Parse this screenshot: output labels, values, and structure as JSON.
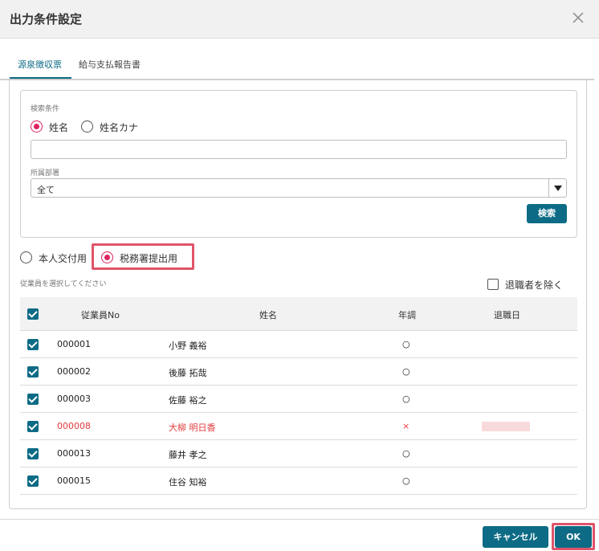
{
  "dialog": {
    "title": "出力条件設定"
  },
  "tabs": [
    {
      "label": "源泉徴収票",
      "active": true
    },
    {
      "label": "給与支払報告書",
      "active": false
    }
  ],
  "search": {
    "section_label": "検索条件",
    "name_options": [
      {
        "label": "姓名",
        "selected": true
      },
      {
        "label": "姓名カナ",
        "selected": false
      }
    ],
    "keyword_value": "",
    "department_label": "所属部署",
    "department_value": "全て",
    "search_button": "検索"
  },
  "output_type": [
    {
      "label": "本人交付用",
      "selected": false
    },
    {
      "label": "税務署提出用",
      "selected": true
    }
  ],
  "employee_hint": "従業員を選択してください",
  "exclude_retired": {
    "label": "退職者を除く",
    "checked": false
  },
  "table": {
    "columns": [
      "従業員No",
      "姓名",
      "年調",
      "退職日"
    ],
    "rows": [
      {
        "no": "000001",
        "name": "小野 義裕",
        "nencho": "○",
        "retired": "",
        "checked": true,
        "error": false
      },
      {
        "no": "000002",
        "name": "後藤 拓哉",
        "nencho": "○",
        "retired": "",
        "checked": true,
        "error": false
      },
      {
        "no": "000003",
        "name": "佐藤 裕之",
        "nencho": "○",
        "retired": "",
        "checked": true,
        "error": false
      },
      {
        "no": "000008",
        "name": "大柳 明日香",
        "nencho": "×",
        "retired": "",
        "checked": true,
        "error": true
      },
      {
        "no": "000013",
        "name": "藤井 孝之",
        "nencho": "○",
        "retired": "",
        "checked": true,
        "error": false
      },
      {
        "no": "000015",
        "name": "住谷 知裕",
        "nencho": "○",
        "retired": "",
        "checked": true,
        "error": false
      }
    ]
  },
  "footer": {
    "cancel_label": "キャンセル",
    "ok_label": "OK"
  },
  "colors": {
    "accent": "#0d6b85",
    "radio_selected": "#e0245e",
    "highlight": "#e0546a",
    "error_text": "#e23b3b"
  }
}
